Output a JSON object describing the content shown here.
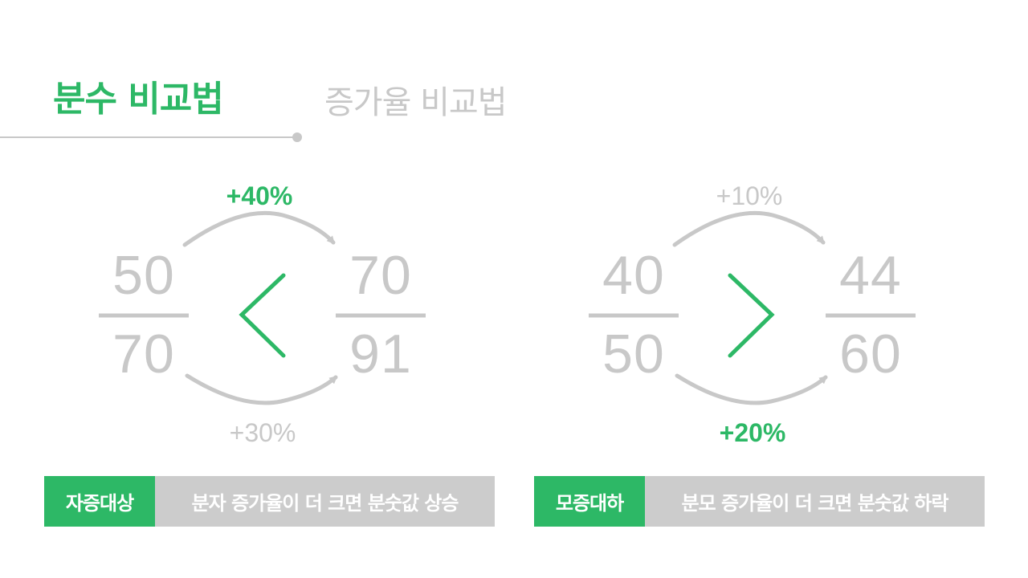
{
  "tabs": {
    "active_label": "분수 비교법",
    "inactive_label": "증가율 비교법"
  },
  "left": {
    "numerator_a": "50",
    "denominator_a": "70",
    "numerator_b": "70",
    "denominator_b": "91",
    "top_rate": "+40%",
    "bottom_rate": "+30%",
    "comparison": "<",
    "tag": "자증대상",
    "description": "분자 증가율이 더 크면 분숫값 상승"
  },
  "right": {
    "numerator_a": "40",
    "denominator_a": "50",
    "numerator_b": "44",
    "denominator_b": "60",
    "top_rate": "+10%",
    "bottom_rate": "+20%",
    "comparison": ">",
    "tag": "모증대하",
    "description": "분모 증가율이 더 크면 분숫값 하락"
  },
  "colors": {
    "accent": "#2db866",
    "muted": "#c8c8c8",
    "label_bg": "#cccccc"
  }
}
